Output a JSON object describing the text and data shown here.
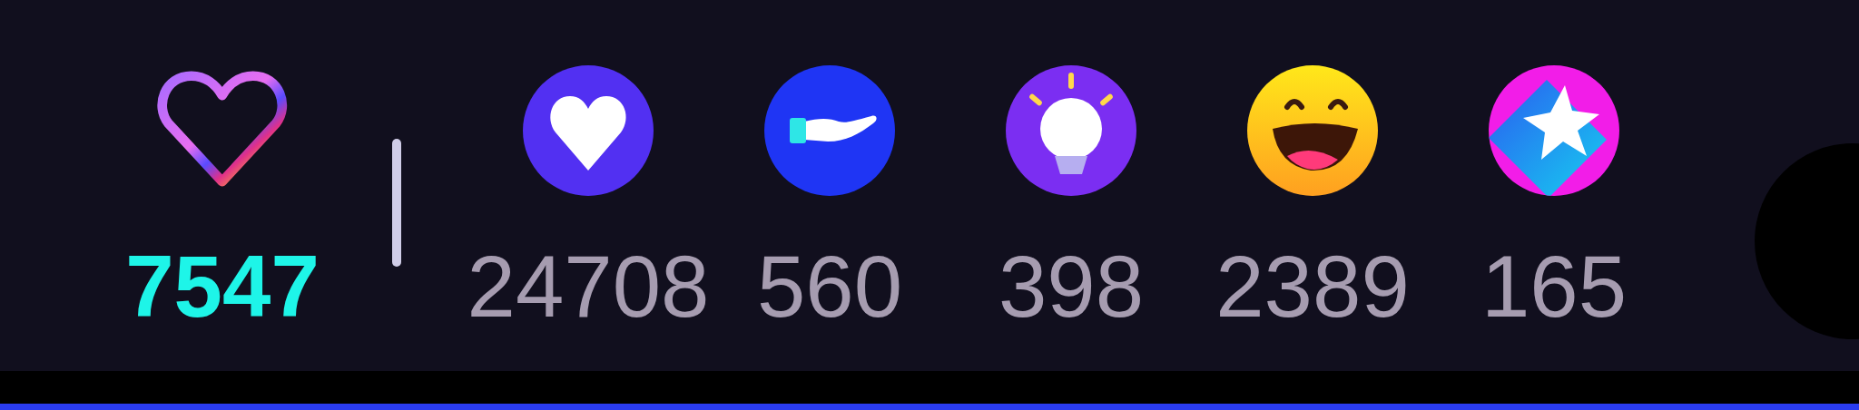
{
  "total": {
    "count": "7547"
  },
  "reactions": [
    {
      "kind": "heart",
      "count": "24708"
    },
    {
      "kind": "hand",
      "count": "560"
    },
    {
      "kind": "bulb",
      "count": "398"
    },
    {
      "kind": "laugh",
      "count": "2389"
    },
    {
      "kind": "star",
      "count": "165"
    }
  ]
}
